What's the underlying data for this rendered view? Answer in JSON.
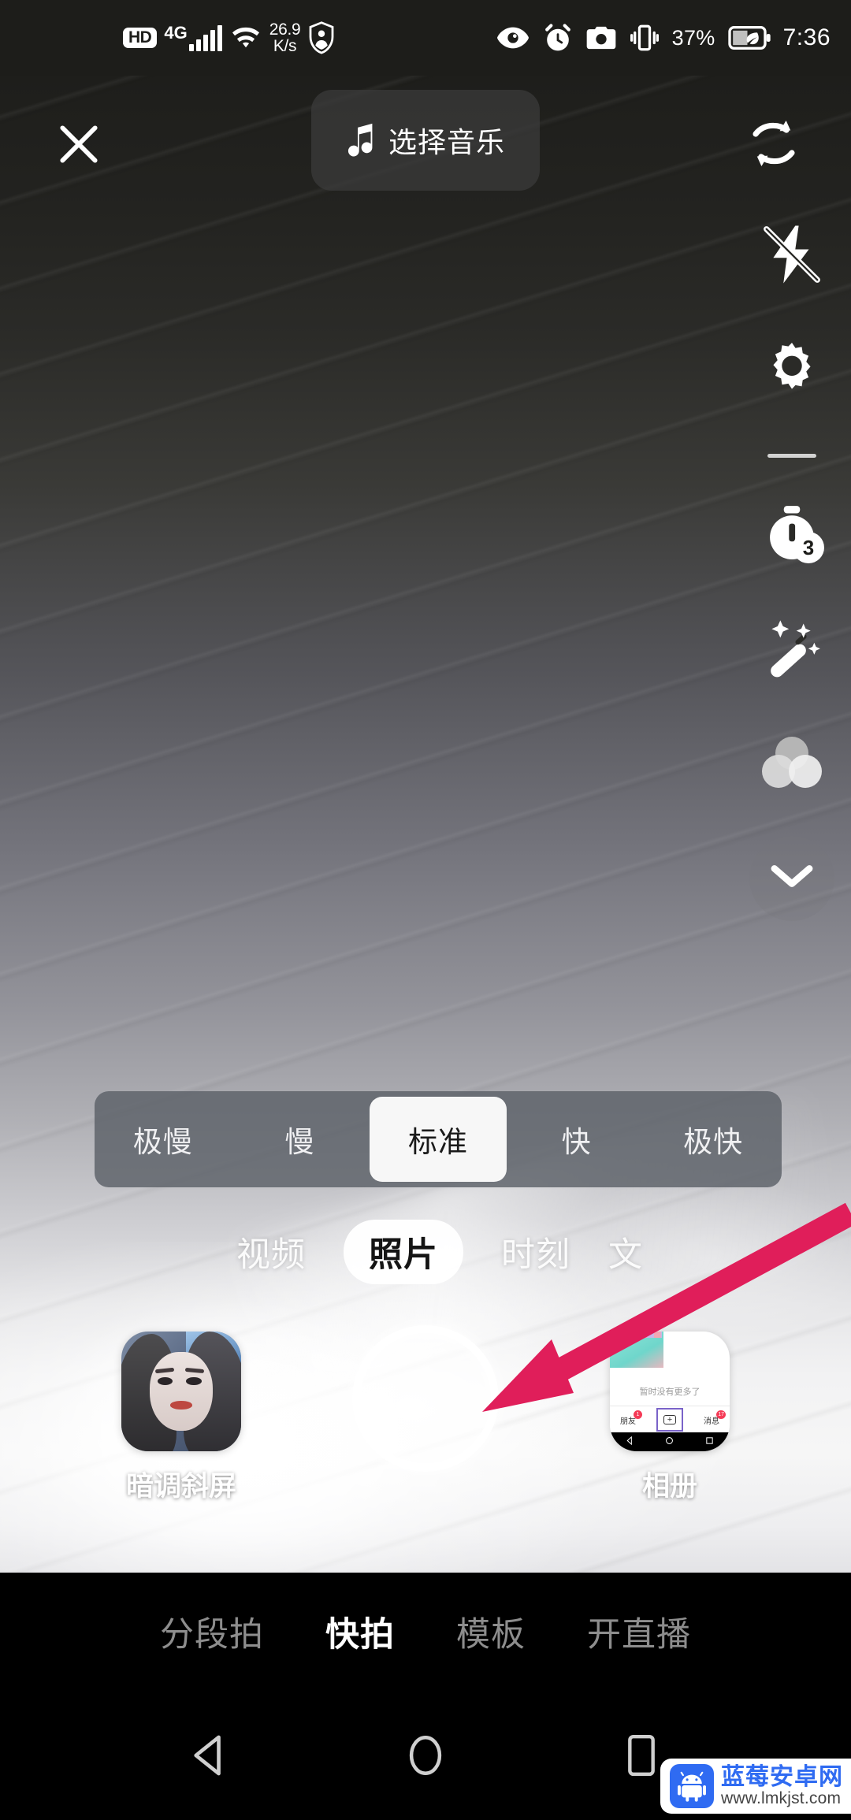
{
  "status_bar": {
    "hd": "HD",
    "network": "4G",
    "net_speed_value": "26.9",
    "net_speed_unit": "K/s",
    "battery_percent": "37%",
    "time": "7:36",
    "icons": [
      "hd-badge",
      "signal-bars-icon",
      "wifi-icon",
      "network-speed",
      "shield-person-icon",
      "eye-icon",
      "alarm-clock-icon",
      "camera-icon",
      "vibrate-icon",
      "battery-leaf-icon"
    ]
  },
  "top_bar": {
    "close_label": "✕",
    "music_label": "选择音乐",
    "music_icon": "music-note-icon",
    "flip_icon": "flip-camera-icon"
  },
  "sidebar": {
    "items": [
      {
        "name": "flash-off-icon",
        "label": ""
      },
      {
        "name": "settings-gear-icon",
        "label": ""
      },
      {
        "name": "divider",
        "label": ""
      },
      {
        "name": "timer-icon",
        "label": "3"
      },
      {
        "name": "beauty-wand-icon",
        "label": ""
      },
      {
        "name": "filter-circles-icon",
        "label": ""
      },
      {
        "name": "chevron-down-icon",
        "label": ""
      }
    ],
    "timer_value": "3"
  },
  "speed_selector": {
    "options": [
      "极慢",
      "慢",
      "标准",
      "快",
      "极快"
    ],
    "selected": "标准"
  },
  "mode_tabs": {
    "tabs": [
      "视频",
      "照片",
      "时刻",
      "文"
    ],
    "selected": "照片"
  },
  "capture_row": {
    "effect_label": "暗调斜屏",
    "album_label": "相册",
    "shutter_name": "shutter-button",
    "album_preview": {
      "empty_text": "暂时没有更多了",
      "nav_friends": "朋友",
      "nav_friends_badge": "1",
      "nav_messages": "消息",
      "nav_messages_badge": "17",
      "plus_label": "+"
    }
  },
  "bottom_nav": {
    "items": [
      "分段拍",
      "快拍",
      "模板",
      "开直播"
    ],
    "selected": "快拍"
  },
  "android_nav": {
    "back": "back-triangle-icon",
    "home": "home-circle-icon",
    "recents": "recents-square-icon"
  },
  "watermark": {
    "site_name": "蓝莓安卓网",
    "url": "www.lmkjst.com"
  },
  "annotation": {
    "arrow_color": "#E01E5A",
    "arrow_from": "1080,1540",
    "arrow_to": "620,1790"
  },
  "colors": {
    "accent_pink": "#E01E5A",
    "status_bar_bg": "#1d1d1a",
    "nav_bg": "#000000",
    "speed_bar_bg": "rgba(92,96,104,0.82)",
    "selected_chip_bg": "#f7f7f7",
    "watermark_blue": "#2f6bf2"
  }
}
